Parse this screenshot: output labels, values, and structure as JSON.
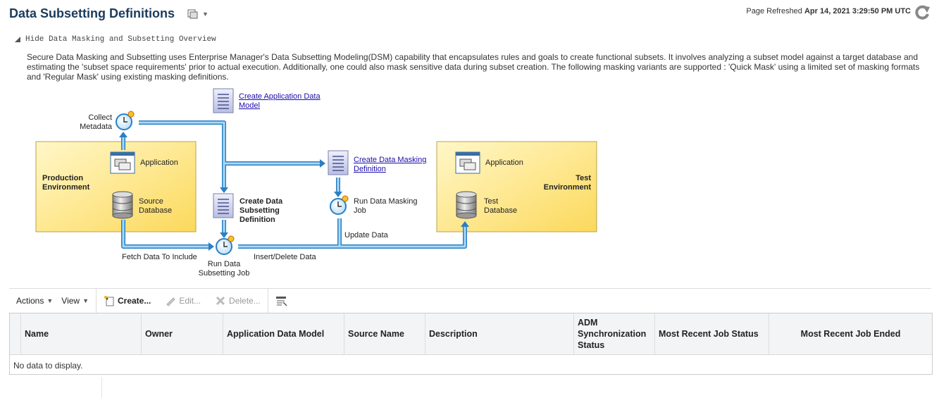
{
  "page": {
    "title": "Data Subsetting Definitions",
    "refresh_prefix": "Page Refreshed",
    "refresh_time": "Apr 14, 2021 3:29:50 PM UTC"
  },
  "overview": {
    "toggle_label": "Hide Data Masking and Subsetting Overview",
    "description": "Secure Data Masking and Subsetting uses Enterprise Manager's Data Subsetting Modeling(DSM) capability that encapsulates rules and goals to create functional subsets. It involves analyzing a subset model against a target database and estimating the 'subset space requirements' prior to actual execution. Additionally, one could also mask sensitive data during subset creation. The following masking variants are supported : 'Quick Mask' using a limited set of masking formats and 'Regular Mask' using existing masking definitions."
  },
  "diagram": {
    "collect": [
      "Collect",
      "Metadata"
    ],
    "create_adm": [
      "Create Application Data",
      "Model"
    ],
    "create_masking": [
      "Create Data Masking",
      "Definition"
    ],
    "prod_env": [
      "Production",
      "Environment"
    ],
    "test_env": [
      "Test",
      "Environment"
    ],
    "application": "Application",
    "source_db": [
      "Source",
      "Database"
    ],
    "test_db": [
      "Test",
      "Database"
    ],
    "create_subset": [
      "Create Data",
      "Subsetting",
      "Definition"
    ],
    "run_masking": [
      "Run Data Masking",
      "Job"
    ],
    "update_data": "Update Data",
    "fetch": "Fetch Data To Include",
    "run_subset": [
      "Run Data",
      "Subsetting Job"
    ],
    "insert_delete": "Insert/Delete Data"
  },
  "toolbar": {
    "actions": "Actions",
    "view": "View",
    "create": "Create...",
    "edit": "Edit...",
    "delete": "Delete..."
  },
  "table": {
    "columns": [
      "Name",
      "Owner",
      "Application Data Model",
      "Source Name",
      "Description",
      "ADM\nSynchronization\nStatus",
      "Most Recent Job Status",
      "Most Recent Job Ended"
    ],
    "empty_text": "No data to display."
  },
  "colors": {
    "title": "#1b3b5c",
    "arrow": "#5aaee6",
    "env_box": "#fde98a",
    "link": "#1a0dab"
  }
}
